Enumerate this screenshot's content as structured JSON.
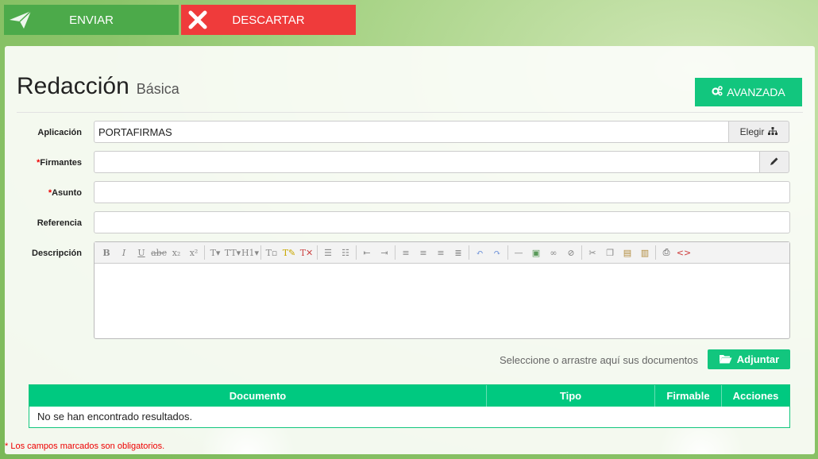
{
  "topbar": {
    "send_label": "ENVIAR",
    "discard_label": "DESCARTAR"
  },
  "header": {
    "title": "Redacción",
    "subtitle": "Básica",
    "advanced_label": "AVANZADA"
  },
  "form": {
    "application": {
      "label": "Aplicación",
      "value": "PORTAFIRMAS",
      "choose_label": "Elegir"
    },
    "signers": {
      "required_mark": "*",
      "label": "Firmantes",
      "value": ""
    },
    "subject": {
      "required_mark": "*",
      "label": "Asunto",
      "value": ""
    },
    "reference": {
      "label": "Referencia",
      "value": ""
    },
    "description": {
      "label": "Descripción"
    }
  },
  "editor_toolbar": [
    "bold",
    "italic",
    "underline",
    "strikethrough",
    "subscript",
    "superscript",
    "font",
    "font-size",
    "heading",
    "format",
    "highlight",
    "remove-format",
    "bulleted-list",
    "numbered-list",
    "outdent",
    "indent",
    "align-left",
    "align-center",
    "align-right",
    "justify",
    "undo",
    "redo",
    "horizontal-rule",
    "image",
    "link",
    "unlink",
    "cut",
    "copy",
    "paste",
    "paste-text",
    "print",
    "source"
  ],
  "attachments": {
    "drop_text": "Seleccione o arrastre aquí sus documentos",
    "attach_label": "Adjuntar"
  },
  "table": {
    "columns": [
      "Documento",
      "Tipo",
      "Firmable",
      "Acciones"
    ],
    "empty_text": "No se han encontrado resultados."
  },
  "footnote": "* Los campos marcados son obligatorios.",
  "colors": {
    "accent": "#12c67e",
    "send": "#4caa4a",
    "discard": "#ef3b3b",
    "required": "#e00000"
  }
}
